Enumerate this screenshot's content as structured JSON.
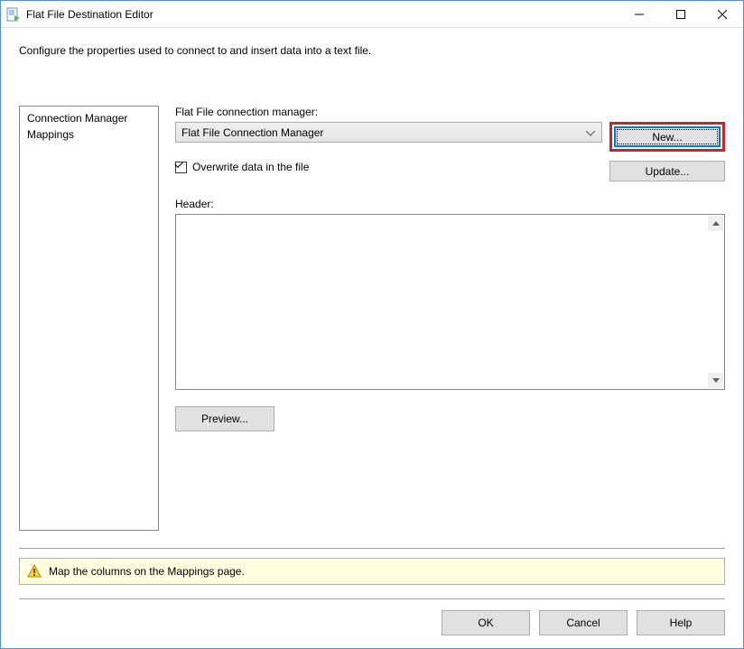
{
  "window": {
    "title": "Flat File Destination Editor"
  },
  "description": "Configure the properties used to connect to and insert data into a text file.",
  "sidebar": {
    "items": [
      {
        "label": "Connection Manager"
      },
      {
        "label": "Mappings"
      }
    ]
  },
  "form": {
    "conn_label": "Flat File connection manager:",
    "conn_selected": "Flat File Connection Manager",
    "new_label": "New...",
    "overwrite_label": "Overwrite data in the file",
    "overwrite_checked": true,
    "update_label": "Update...",
    "header_label": "Header:",
    "header_value": "",
    "preview_label": "Preview..."
  },
  "status": {
    "message": "Map the columns on the Mappings page."
  },
  "footer": {
    "ok": "OK",
    "cancel": "Cancel",
    "help": "Help"
  }
}
